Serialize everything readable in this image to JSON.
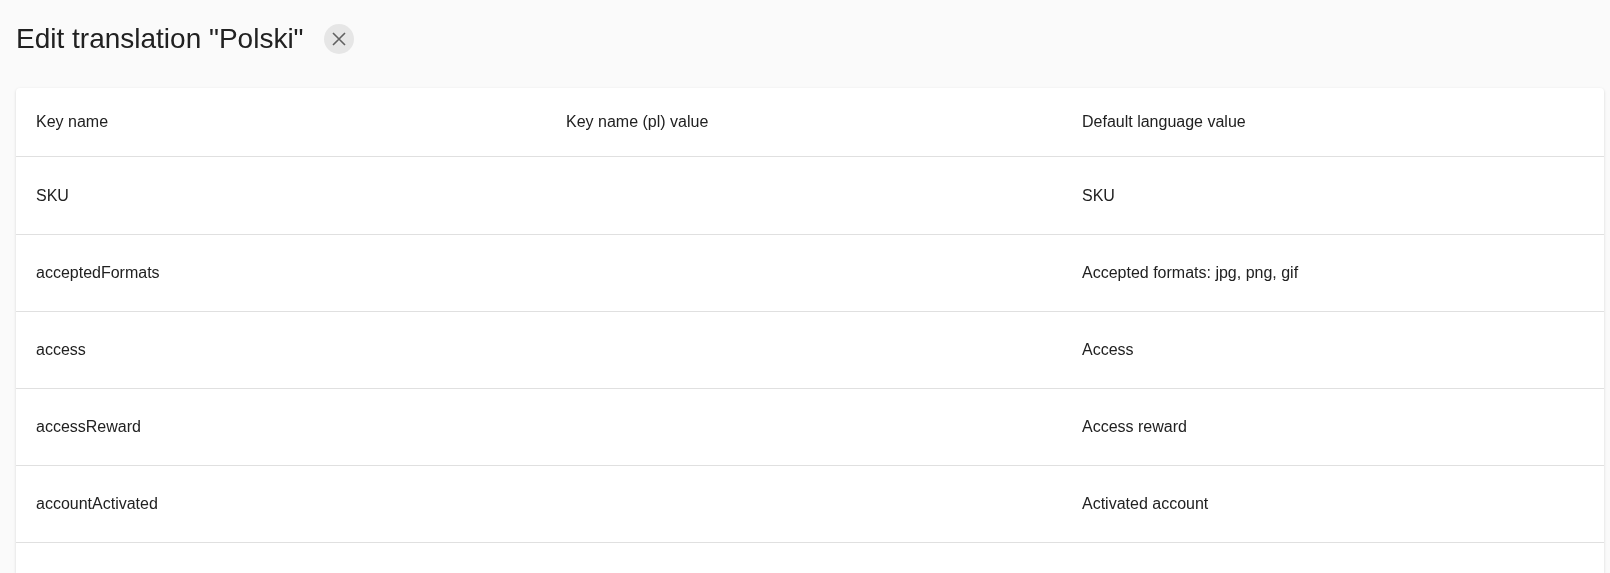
{
  "title": "Edit translation \"Polski\"",
  "table": {
    "columns": [
      "Key name",
      "Key name (pl) value",
      "Default language value"
    ],
    "rows": [
      {
        "key": "SKU",
        "value": "",
        "default": "SKU"
      },
      {
        "key": "acceptedFormats",
        "value": "",
        "default": "Accepted formats: jpg, png, gif"
      },
      {
        "key": "access",
        "value": "",
        "default": "Access"
      },
      {
        "key": "accessReward",
        "value": "",
        "default": "Access reward"
      },
      {
        "key": "accountActivated",
        "value": "",
        "default": "Activated account"
      }
    ]
  }
}
